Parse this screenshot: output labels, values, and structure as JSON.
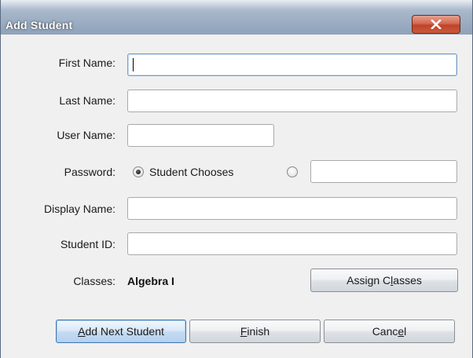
{
  "dialog": {
    "title": "Add Student",
    "close_icon": "close-x-icon"
  },
  "form": {
    "first_name": {
      "label": "First Name:",
      "value": "",
      "focused": true
    },
    "last_name": {
      "label": "Last Name:",
      "value": ""
    },
    "user_name": {
      "label": "User Name:",
      "value": ""
    },
    "password": {
      "label": "Password:",
      "option_student_chooses": {
        "label": "Student Chooses",
        "selected": true
      },
      "option_custom": {
        "label": "",
        "selected": false,
        "value": ""
      }
    },
    "display_name": {
      "label": "Display Name:",
      "value": ""
    },
    "student_id": {
      "label": "Student ID:",
      "value": ""
    },
    "classes": {
      "label": "Classes:",
      "value": "Algebra I"
    }
  },
  "buttons": {
    "assign_classes": {
      "pre": "Assign C",
      "mnemonic": "l",
      "post": "asses"
    },
    "add_next_student": {
      "pre": "",
      "mnemonic": "A",
      "post": "dd Next Student"
    },
    "finish": {
      "pre": "",
      "mnemonic": "F",
      "post": "inish"
    },
    "cancel": {
      "pre": "Canc",
      "mnemonic": "e",
      "post": "l"
    }
  },
  "colors": {
    "close_button": "#c9452c",
    "default_button_border": "#3f79b8",
    "dialog_background": "#f0f0f0"
  }
}
